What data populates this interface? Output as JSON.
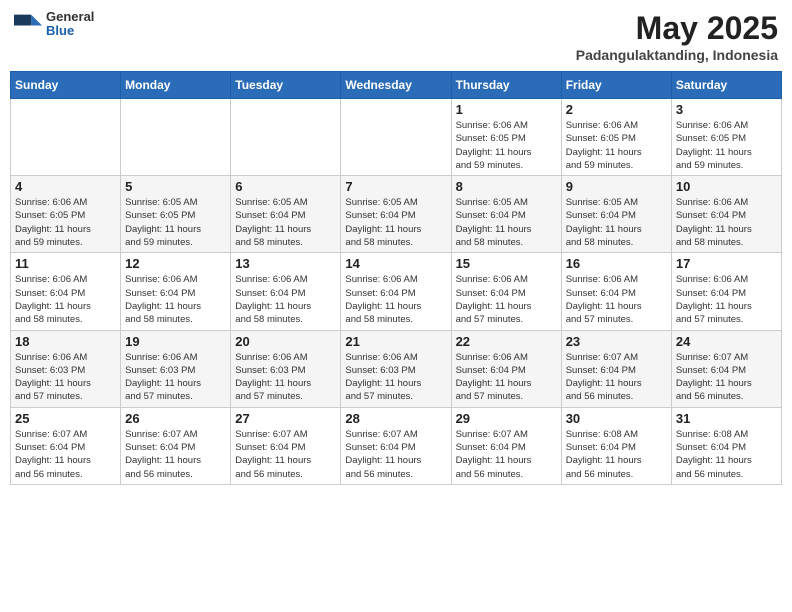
{
  "header": {
    "logo_general": "General",
    "logo_blue": "Blue",
    "month_title": "May 2025",
    "location": "Padangulaktanding, Indonesia"
  },
  "weekdays": [
    "Sunday",
    "Monday",
    "Tuesday",
    "Wednesday",
    "Thursday",
    "Friday",
    "Saturday"
  ],
  "weeks": [
    [
      {
        "day": "",
        "info": ""
      },
      {
        "day": "",
        "info": ""
      },
      {
        "day": "",
        "info": ""
      },
      {
        "day": "",
        "info": ""
      },
      {
        "day": "1",
        "info": "Sunrise: 6:06 AM\nSunset: 6:05 PM\nDaylight: 11 hours\nand 59 minutes."
      },
      {
        "day": "2",
        "info": "Sunrise: 6:06 AM\nSunset: 6:05 PM\nDaylight: 11 hours\nand 59 minutes."
      },
      {
        "day": "3",
        "info": "Sunrise: 6:06 AM\nSunset: 6:05 PM\nDaylight: 11 hours\nand 59 minutes."
      }
    ],
    [
      {
        "day": "4",
        "info": "Sunrise: 6:06 AM\nSunset: 6:05 PM\nDaylight: 11 hours\nand 59 minutes."
      },
      {
        "day": "5",
        "info": "Sunrise: 6:05 AM\nSunset: 6:05 PM\nDaylight: 11 hours\nand 59 minutes."
      },
      {
        "day": "6",
        "info": "Sunrise: 6:05 AM\nSunset: 6:04 PM\nDaylight: 11 hours\nand 58 minutes."
      },
      {
        "day": "7",
        "info": "Sunrise: 6:05 AM\nSunset: 6:04 PM\nDaylight: 11 hours\nand 58 minutes."
      },
      {
        "day": "8",
        "info": "Sunrise: 6:05 AM\nSunset: 6:04 PM\nDaylight: 11 hours\nand 58 minutes."
      },
      {
        "day": "9",
        "info": "Sunrise: 6:05 AM\nSunset: 6:04 PM\nDaylight: 11 hours\nand 58 minutes."
      },
      {
        "day": "10",
        "info": "Sunrise: 6:06 AM\nSunset: 6:04 PM\nDaylight: 11 hours\nand 58 minutes."
      }
    ],
    [
      {
        "day": "11",
        "info": "Sunrise: 6:06 AM\nSunset: 6:04 PM\nDaylight: 11 hours\nand 58 minutes."
      },
      {
        "day": "12",
        "info": "Sunrise: 6:06 AM\nSunset: 6:04 PM\nDaylight: 11 hours\nand 58 minutes."
      },
      {
        "day": "13",
        "info": "Sunrise: 6:06 AM\nSunset: 6:04 PM\nDaylight: 11 hours\nand 58 minutes."
      },
      {
        "day": "14",
        "info": "Sunrise: 6:06 AM\nSunset: 6:04 PM\nDaylight: 11 hours\nand 58 minutes."
      },
      {
        "day": "15",
        "info": "Sunrise: 6:06 AM\nSunset: 6:04 PM\nDaylight: 11 hours\nand 57 minutes."
      },
      {
        "day": "16",
        "info": "Sunrise: 6:06 AM\nSunset: 6:04 PM\nDaylight: 11 hours\nand 57 minutes."
      },
      {
        "day": "17",
        "info": "Sunrise: 6:06 AM\nSunset: 6:04 PM\nDaylight: 11 hours\nand 57 minutes."
      }
    ],
    [
      {
        "day": "18",
        "info": "Sunrise: 6:06 AM\nSunset: 6:03 PM\nDaylight: 11 hours\nand 57 minutes."
      },
      {
        "day": "19",
        "info": "Sunrise: 6:06 AM\nSunset: 6:03 PM\nDaylight: 11 hours\nand 57 minutes."
      },
      {
        "day": "20",
        "info": "Sunrise: 6:06 AM\nSunset: 6:03 PM\nDaylight: 11 hours\nand 57 minutes."
      },
      {
        "day": "21",
        "info": "Sunrise: 6:06 AM\nSunset: 6:03 PM\nDaylight: 11 hours\nand 57 minutes."
      },
      {
        "day": "22",
        "info": "Sunrise: 6:06 AM\nSunset: 6:04 PM\nDaylight: 11 hours\nand 57 minutes."
      },
      {
        "day": "23",
        "info": "Sunrise: 6:07 AM\nSunset: 6:04 PM\nDaylight: 11 hours\nand 56 minutes."
      },
      {
        "day": "24",
        "info": "Sunrise: 6:07 AM\nSunset: 6:04 PM\nDaylight: 11 hours\nand 56 minutes."
      }
    ],
    [
      {
        "day": "25",
        "info": "Sunrise: 6:07 AM\nSunset: 6:04 PM\nDaylight: 11 hours\nand 56 minutes."
      },
      {
        "day": "26",
        "info": "Sunrise: 6:07 AM\nSunset: 6:04 PM\nDaylight: 11 hours\nand 56 minutes."
      },
      {
        "day": "27",
        "info": "Sunrise: 6:07 AM\nSunset: 6:04 PM\nDaylight: 11 hours\nand 56 minutes."
      },
      {
        "day": "28",
        "info": "Sunrise: 6:07 AM\nSunset: 6:04 PM\nDaylight: 11 hours\nand 56 minutes."
      },
      {
        "day": "29",
        "info": "Sunrise: 6:07 AM\nSunset: 6:04 PM\nDaylight: 11 hours\nand 56 minutes."
      },
      {
        "day": "30",
        "info": "Sunrise: 6:08 AM\nSunset: 6:04 PM\nDaylight: 11 hours\nand 56 minutes."
      },
      {
        "day": "31",
        "info": "Sunrise: 6:08 AM\nSunset: 6:04 PM\nDaylight: 11 hours\nand 56 minutes."
      }
    ]
  ]
}
